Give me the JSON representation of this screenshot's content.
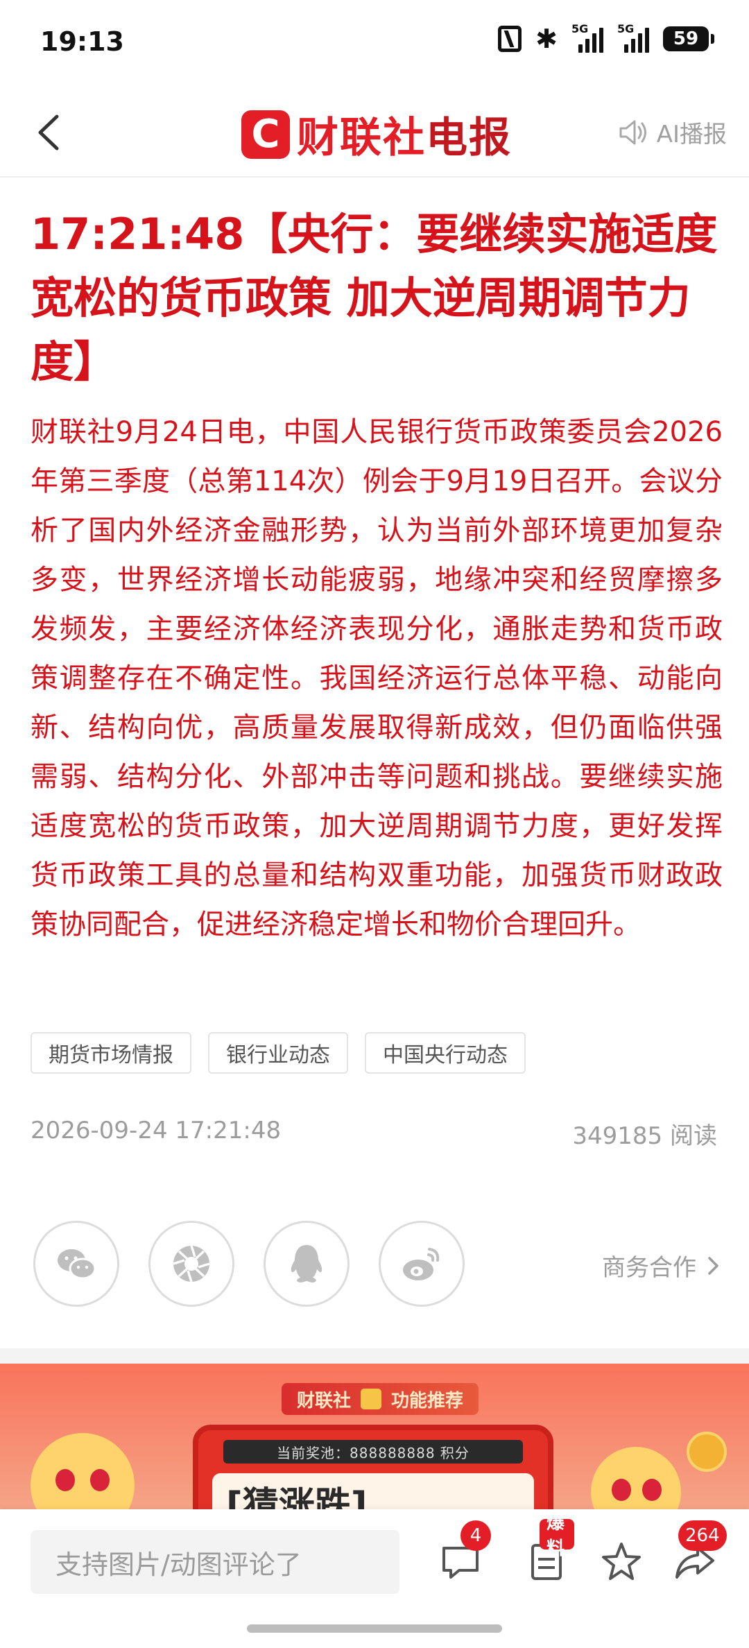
{
  "status_bar": {
    "time": "19:13",
    "network_1": "5G",
    "network_2": "5G",
    "battery": "59"
  },
  "header": {
    "logo_mark": "C",
    "logo_text_a": "财联社",
    "logo_text_b": "电报",
    "ai_label": "AI播报"
  },
  "article": {
    "title": "17:21:48【央行：要继续实施适度宽松的货币政策 加大逆周期调节力度】",
    "body": "财联社9月24日电，中国人民银行货币政策委员会2026年第三季度（总第114次）例会于9月19日召开。会议分析了国内外经济金融形势，认为当前外部环境更加复杂多变，世界经济增长动能疲弱，地缘冲突和经贸摩擦多发频发，主要经济体经济表现分化，通胀走势和货币政策调整存在不确定性。我国经济运行总体平稳、动能向新、结构向优，高质量发展取得新成效，但仍面临供强需弱、结构分化、外部冲击等问题和挑战。要继续实施适度宽松的货币政策，加大逆周期调节力度，更好发挥货币政策工具的总量和结构双重功能，加强货币财政政策协同配合，促进经济稳定增长和物价合理回升。",
    "tags": [
      "期货市场情报",
      "银行业动态",
      "中国央行动态"
    ],
    "date": "2026-09-24 17:21:48",
    "reads": "349185 阅读"
  },
  "share": {
    "icons": [
      "wechat-icon",
      "moments-icon",
      "qq-icon",
      "weibo-icon"
    ],
    "business_link": "商务合作"
  },
  "banner": {
    "pill_left": "财联社",
    "pill_right": "功能推荐",
    "pool_text": "当前奖池：888888888 积分",
    "big_text": "[猜涨跌]"
  },
  "bottom_bar": {
    "comment_placeholder": "支持图片/动图评论了",
    "comment_count": "4",
    "report_label": "爆料",
    "share_count": "264"
  },
  "colors": {
    "accent": "#e41e26",
    "article_text": "#d6121b",
    "muted": "#9c9c9c"
  }
}
